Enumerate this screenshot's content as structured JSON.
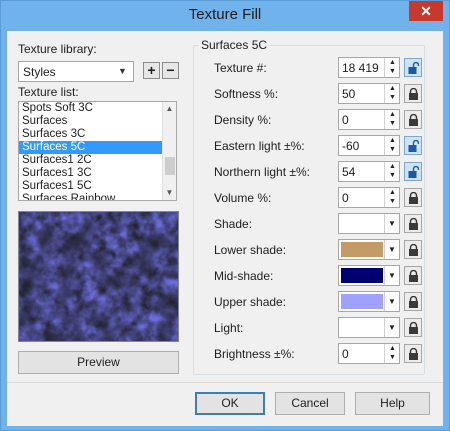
{
  "window": {
    "title": "Texture Fill",
    "close_glyph": "✕"
  },
  "library": {
    "label": "Texture library:",
    "selected": "Styles",
    "add_glyph": "+",
    "remove_glyph": "−"
  },
  "texture_list": {
    "label": "Texture list:",
    "items": [
      "Spots Soft 3C",
      "Surfaces",
      "Surfaces 3C",
      "Surfaces 5C",
      "Surfaces1 2C",
      "Surfaces1 3C",
      "Surfaces1 5C",
      "Surfaces Rainbow"
    ],
    "selected_index": 3
  },
  "preview_button": "Preview",
  "params": {
    "group_title": "Surfaces 5C",
    "texture": {
      "label": "Texture #:",
      "value": "18 419",
      "lock": "open"
    },
    "softness": {
      "label": "Softness %:",
      "value": "50",
      "lock": "locked"
    },
    "density": {
      "label": "Density %:",
      "value": "0",
      "lock": "locked"
    },
    "eastern": {
      "label": "Eastern light ±%:",
      "value": "-60",
      "lock": "open"
    },
    "northern": {
      "label": "Northern light ±%:",
      "value": "54",
      "lock": "open"
    },
    "volume": {
      "label": "Volume %:",
      "value": "0",
      "lock": "locked"
    },
    "shade": {
      "label": "Shade:",
      "color": "#ffffff",
      "lock": "locked"
    },
    "lower_shade": {
      "label": "Lower shade:",
      "color": "#c49a66",
      "lock": "locked"
    },
    "mid_shade": {
      "label": "Mid-shade:",
      "color": "#000070",
      "lock": "locked"
    },
    "upper_shade": {
      "label": "Upper shade:",
      "color": "#a0a0ff",
      "lock": "locked"
    },
    "light": {
      "label": "Light:",
      "color": "#ffffff",
      "lock": "locked"
    },
    "brightness": {
      "label": "Brightness ±%:",
      "value": "0",
      "lock": "locked"
    }
  },
  "buttons": {
    "ok": "OK",
    "cancel": "Cancel",
    "help": "Help"
  },
  "icons": {
    "lock_closed": "lock-closed-icon",
    "lock_open": "lock-open-icon"
  }
}
